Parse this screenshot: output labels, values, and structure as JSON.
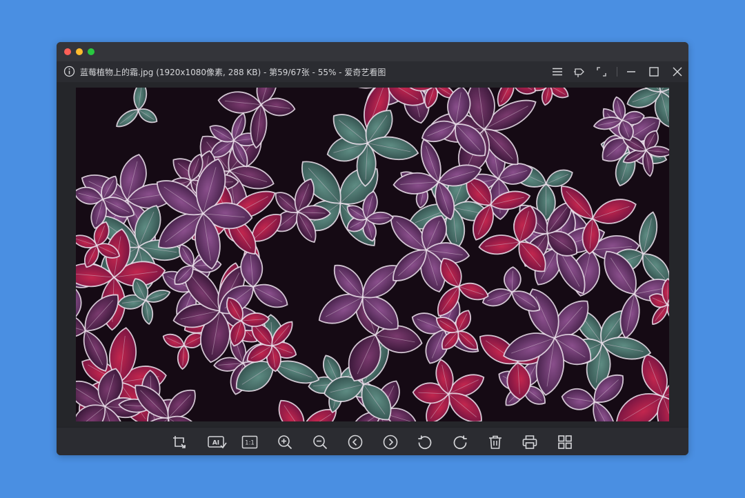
{
  "window": {
    "title": "蓝莓植物上的霜.jpg (1920x1080像素, 288 KB) - 第59/67张 - 55% - 爱奇艺看图"
  },
  "titlebar_icons": [
    "menu-icon",
    "pin-icon",
    "fullscreen-icon",
    "minimize-icon",
    "maximize-icon",
    "close-icon"
  ],
  "toolbar": {
    "ai_label": "AI",
    "actual_size_label": "1:1",
    "icons": [
      "crop-icon",
      "ai-enhance-icon",
      "actual-size-icon",
      "zoom-in-icon",
      "zoom-out-icon",
      "previous-icon",
      "next-icon",
      "rotate-left-icon",
      "rotate-right-icon",
      "delete-icon",
      "print-icon",
      "grid-view-icon"
    ]
  },
  "colors": {
    "desktop": "#4a8fe2",
    "window": "#2b2c31",
    "icon": "#d6d7da"
  }
}
